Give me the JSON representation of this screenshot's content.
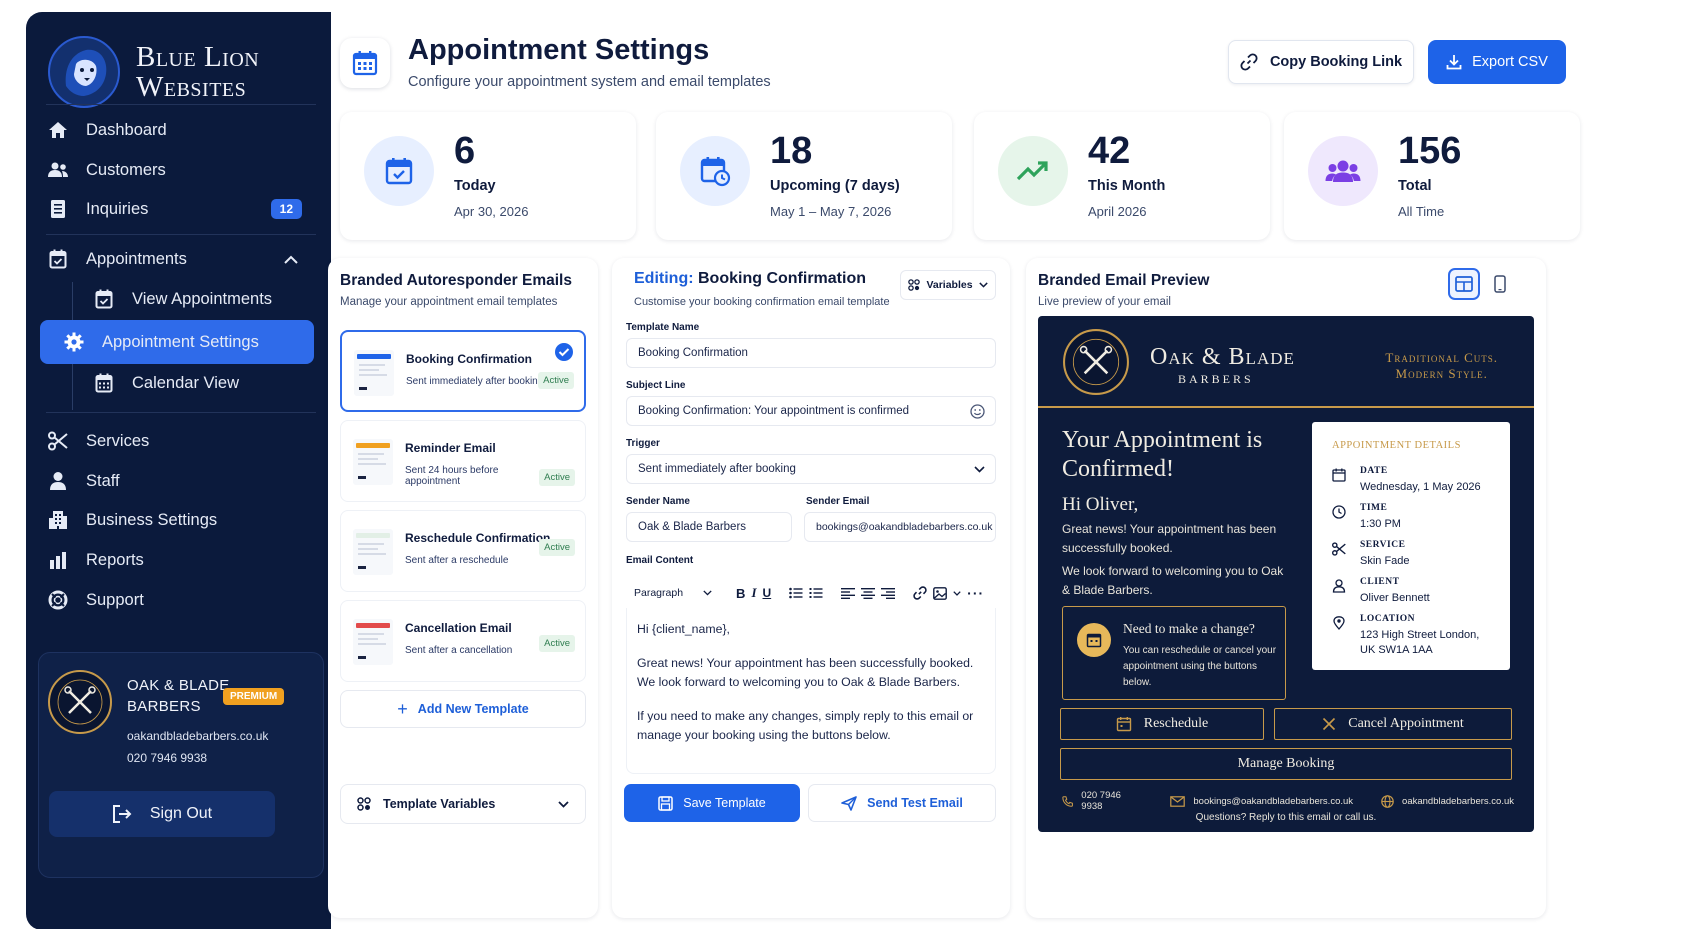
{
  "brand": {
    "line1": "Blue Lion",
    "line2": "Websites"
  },
  "nav": {
    "dashboard": "Dashboard",
    "customers": "Customers",
    "inquiries": "Inquiries",
    "inquiries_badge": "12",
    "appointments": "Appointments",
    "view_appointments": "View Appointments",
    "appointment_settings": "Appointment Settings",
    "calendar_view": "Calendar View",
    "services": "Services",
    "staff": "Staff",
    "business_settings": "Business Settings",
    "reports": "Reports",
    "support": "Support"
  },
  "business": {
    "name_line1": "OAK & BLADE",
    "name_line2": "BARBERS",
    "badge": "PREMIUM",
    "website": "oakandbladebarbers.co.uk",
    "phone": "020 7946 9938",
    "sign_out": "Sign Out"
  },
  "header": {
    "title": "Appointment Settings",
    "subtitle": "Configure your appointment system and email templates",
    "copy_link": "Copy Booking Link",
    "export_csv": "Export CSV"
  },
  "stats": [
    {
      "value": "6",
      "label": "Today",
      "sub": "Apr 30, 2026"
    },
    {
      "value": "18",
      "label": "Upcoming (7 days)",
      "sub": "May 1 – May 7, 2026"
    },
    {
      "value": "42",
      "label": "This Month",
      "sub": "April 2026"
    },
    {
      "value": "156",
      "label": "Total",
      "sub": "All Time"
    }
  ],
  "templates_panel": {
    "title": "Branded Autoresponder Emails",
    "subtitle": "Manage your appointment email templates",
    "items": [
      {
        "name": "Booking Confirmation",
        "desc": "Sent immediately after booking",
        "status": "Active"
      },
      {
        "name": "Reminder Email",
        "desc": "Sent 24 hours before appointment",
        "status": "Active"
      },
      {
        "name": "Reschedule Confirmation",
        "desc": "Sent after a reschedule",
        "status": "Active"
      },
      {
        "name": "Cancellation Email",
        "desc": "Sent after a cancellation",
        "status": "Active"
      }
    ],
    "add_new": "Add New Template",
    "template_variables": "Template Variables"
  },
  "editor": {
    "editing_label": "Editing:",
    "editing_name": "Booking Confirmation",
    "subtitle": "Customise your booking confirmation email template",
    "variables_btn": "Variables",
    "template_name_label": "Template Name",
    "template_name_value": "Booking Confirmation",
    "subject_label": "Subject Line",
    "subject_value": "Booking Confirmation: Your appointment is confirmed",
    "trigger_label": "Trigger",
    "trigger_value": "Sent immediately after booking",
    "sender_name_label": "Sender Name",
    "sender_name_value": "Oak & Blade Barbers",
    "sender_email_label": "Sender Email",
    "sender_email_value": "bookings@oakandbladebarbers.co.uk",
    "content_label": "Email Content",
    "paragraph_select": "Paragraph",
    "body_greeting": "Hi {client_name},",
    "body_p1": "Great news! Your appointment has been successfully booked. We look forward to welcoming you to Oak & Blade Barbers.",
    "body_p2": "If you need to make any changes, simply reply to this email or manage your booking using the buttons below.",
    "save": "Save Template",
    "send_test": "Send Test Email"
  },
  "preview": {
    "title": "Branded Email Preview",
    "subtitle": "Live preview of your email",
    "email": {
      "brand_line1": "Oak & Blade",
      "brand_line2": "BARBERS",
      "tagline_line1": "Traditional Cuts.",
      "tagline_line2": "Modern Style.",
      "heading": "Your Appointment is Confirmed!",
      "greeting": "Hi Oliver,",
      "p1": "Great news! Your appointment has been successfully booked.",
      "p2": "We look forward to welcoming you to Oak & Blade Barbers.",
      "change_title": "Need to make a change?",
      "change_desc": "You can reschedule or cancel your appointment using the buttons below.",
      "details_title": "APPOINTMENT DETAILS",
      "details": {
        "date_label": "DATE",
        "date_value": "Wednesday, 1 May 2026",
        "time_label": "TIME",
        "time_value": "1:30 PM",
        "service_label": "SERVICE",
        "service_value": "Skin Fade",
        "client_label": "CLIENT",
        "client_value": "Oliver Bennett",
        "location_label": "LOCATION",
        "location_value": "123 High Street London, UK SW1A 1AA"
      },
      "reschedule": "Reschedule",
      "cancel": "Cancel Appointment",
      "manage": "Manage Booking",
      "footer_phone": "020 7946 9938",
      "footer_email": "bookings@oakandbladebarbers.co.uk",
      "footer_web": "oakandbladebarbers.co.uk",
      "footer_question": "Questions? Reply to this email or call us."
    }
  },
  "colors": {
    "sidebar": "#0b1a3c",
    "accent": "#2f6bea",
    "gold": "#c79a4a",
    "email_bg": "#0d1b3a"
  }
}
